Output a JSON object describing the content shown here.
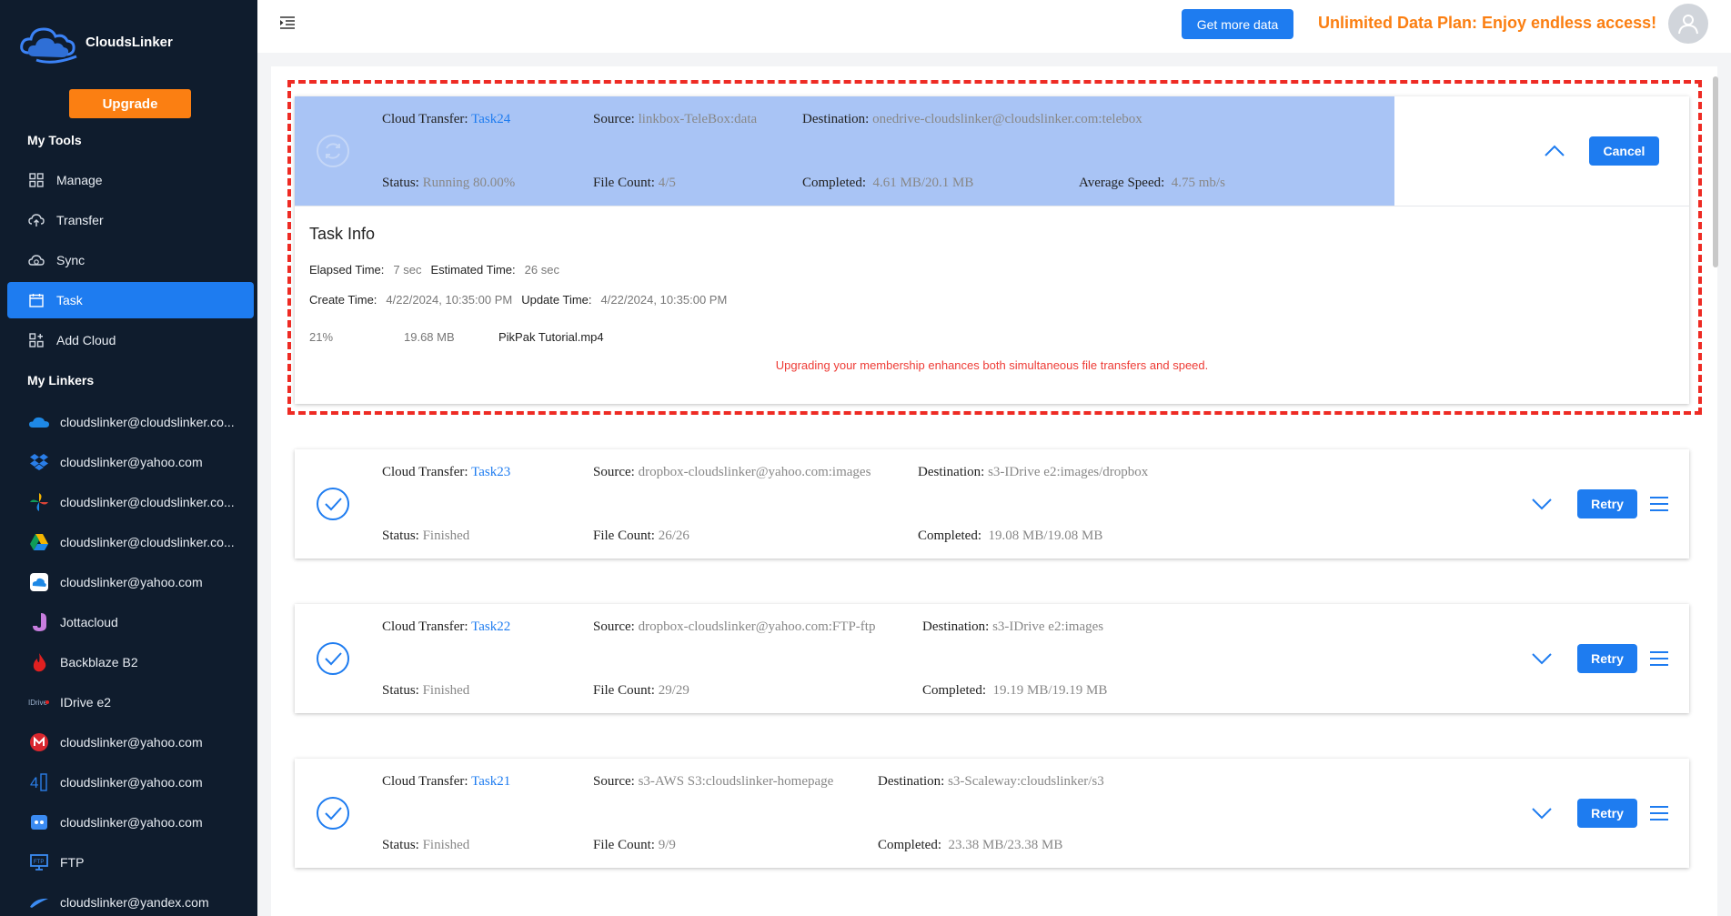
{
  "brand": {
    "name": "CloudsLinker"
  },
  "sidebar": {
    "upgrade_label": "Upgrade",
    "tools_title": "My Tools",
    "tools": [
      {
        "label": "Manage",
        "icon": "grid-icon"
      },
      {
        "label": "Transfer",
        "icon": "cloud-upload-icon"
      },
      {
        "label": "Sync",
        "icon": "cloud-sync-icon"
      },
      {
        "label": "Task",
        "icon": "calendar-icon",
        "active": true
      },
      {
        "label": "Add Cloud",
        "icon": "add-grid-icon"
      }
    ],
    "linkers_title": "My Linkers",
    "linkers": [
      {
        "label": "cloudslinker@cloudslinker.co...",
        "icon": "onedrive-icon"
      },
      {
        "label": "cloudslinker@yahoo.com",
        "icon": "dropbox-icon"
      },
      {
        "label": "cloudslinker@cloudslinker.co...",
        "icon": "pinwheel-icon"
      },
      {
        "label": "cloudslinker@cloudslinker.co...",
        "icon": "google-drive-icon"
      },
      {
        "label": "cloudslinker@yahoo.com",
        "icon": "cloud-app-icon"
      },
      {
        "label": "Jottacloud",
        "icon": "jottacloud-icon"
      },
      {
        "label": "Backblaze B2",
        "icon": "backblaze-flame-icon"
      },
      {
        "label": "IDrive e2",
        "icon": "idrive-icon"
      },
      {
        "label": "cloudslinker@yahoo.com",
        "icon": "mega-icon"
      },
      {
        "label": "cloudslinker@yahoo.com",
        "icon": "4shared-icon"
      },
      {
        "label": "cloudslinker@yahoo.com",
        "icon": "bot-icon"
      },
      {
        "label": "FTP",
        "icon": "ftp-icon"
      },
      {
        "label": "cloudslinker@yandex.com",
        "icon": "yandex-icon"
      }
    ]
  },
  "header": {
    "get_data_label": "Get more data",
    "promo": "Unlimited Data Plan: Enjoy endless access!"
  },
  "labels": {
    "cloud_transfer": "Cloud Transfer:",
    "source": "Source:",
    "destination": "Destination:",
    "status": "Status:",
    "file_count": "File Count:",
    "completed": "Completed:",
    "average_speed": "Average Speed:"
  },
  "active_task": {
    "name": "Task24",
    "source": "linkbox-TeleBox:data",
    "destination": "onedrive-cloudslinker@cloudslinker.com:telebox",
    "status": "Running 80.00%",
    "progress": 0.8,
    "file_count": "4/5",
    "completed": "4.61 MB/20.1 MB",
    "average_speed": "4.75 mb/s",
    "cancel_label": "Cancel",
    "info": {
      "title": "Task Info",
      "elapsed_label": "Elapsed Time:",
      "elapsed": "7 sec",
      "estimated_label": "Estimated Time:",
      "estimated": "26 sec",
      "create_label": "Create Time:",
      "create": "4/22/2024, 10:35:00 PM",
      "update_label": "Update Time:",
      "update": "4/22/2024, 10:35:00 PM",
      "file": {
        "percent": "21%",
        "size": "19.68 MB",
        "name": "PikPak Tutorial.mp4"
      },
      "warning": "Upgrading your membership enhances both simultaneous file transfers and speed."
    }
  },
  "tasks": [
    {
      "name": "Task23",
      "source": "dropbox-cloudslinker@yahoo.com:images",
      "destination": "s3-IDrive e2:images/dropbox",
      "status": "Finished",
      "file_count": "26/26",
      "completed": "19.08 MB/19.08 MB",
      "retry_label": "Retry"
    },
    {
      "name": "Task22",
      "source": "dropbox-cloudslinker@yahoo.com:FTP-ftp",
      "destination": "s3-IDrive e2:images",
      "status": "Finished",
      "file_count": "29/29",
      "completed": "19.19 MB/19.19 MB",
      "retry_label": "Retry"
    },
    {
      "name": "Task21",
      "source": "s3-AWS S3:cloudslinker-homepage",
      "destination": "s3-Scaleway:cloudslinker/s3",
      "status": "Finished",
      "file_count": "9/9",
      "completed": "23.38 MB/23.38 MB",
      "retry_label": "Retry"
    }
  ]
}
